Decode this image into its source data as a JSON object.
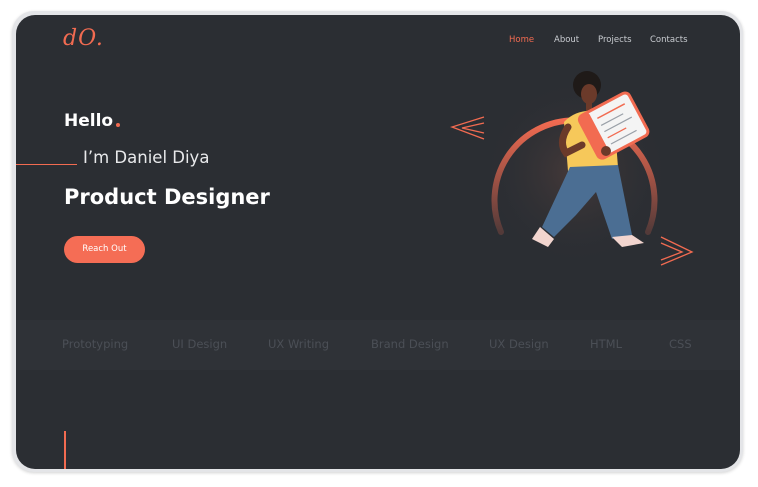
{
  "logo": "dO.",
  "nav": {
    "items": [
      {
        "label": "Home",
        "active": true
      },
      {
        "label": "About",
        "active": false
      },
      {
        "label": "Projects",
        "active": false
      },
      {
        "label": "Contacts",
        "active": false
      }
    ]
  },
  "hero": {
    "greeting": "Hello",
    "name": "I’m Daniel Diya",
    "role": "Product Designer",
    "cta_label": "Reach Out"
  },
  "skills": [
    "Prototyping",
    "UI Design",
    "UX Writing",
    "Brand Design",
    "UX Design",
    "HTML",
    "CSS"
  ],
  "colors": {
    "accent": "#f26b51",
    "background": "#2b2e33",
    "skill_text": "#4b4f56"
  },
  "icons": [
    "code-left-chevron-icon",
    "code-right-chevron-icon"
  ]
}
